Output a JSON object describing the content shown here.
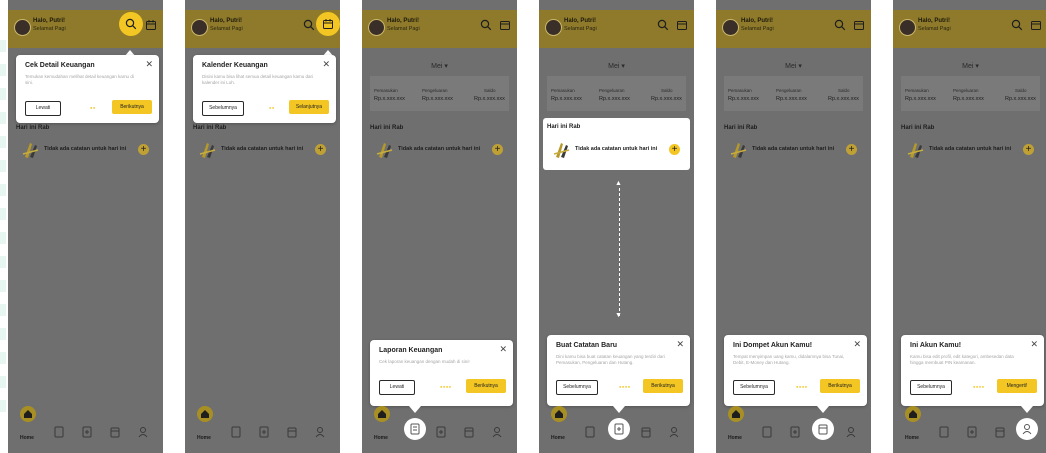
{
  "colors": {
    "accent": "#f3c623",
    "overlay": "#6f6f6f",
    "card": "#ffffff"
  },
  "common": {
    "hello": "Halo, Putri!",
    "greeting": "Selamat Pagi",
    "month": "Mei",
    "income_label": "Pemasukan",
    "expense_label": "Pengeluaran",
    "balance_label": "Saldo",
    "amount": "Rp.x.xxx.xxx",
    "day_title": "Hari ini Rab",
    "empty_text": "Tidak ada catatan untuk hari ini",
    "home_label": "Home",
    "icons": [
      "search-icon",
      "calendar-icon",
      "home-icon",
      "report-icon",
      "add-note-icon",
      "wallet-icon",
      "profile-icon"
    ]
  },
  "cards": [
    {
      "title": "Cek Detail Keuangan",
      "desc": "Temukan kemudahan melihat detail keuangan kamu di sini.",
      "left": "Lewati",
      "right": "Berikutnya"
    },
    {
      "title": "Kalender Keuangan",
      "desc": "Disini kamu bisa lihat semua detail keuangan kamu dari kalender ini Loh.",
      "left": "Sebelumnya",
      "right": "Selanjutnya"
    },
    {
      "title": "Laporan Keuangan",
      "desc": "Cek laporan keuangan dengan mudah di sini!",
      "left": "Lewati",
      "right": "Berikutnya"
    },
    {
      "title": "Buat Catatan Baru",
      "desc": "Dini kamu bisa buat catatan keuangan yang terdiri dari Pemasukan, Pengeluaran dan Hutang.",
      "left": "Sebelumnya",
      "right": "Berikutnya"
    },
    {
      "title": "Ini Dompet Akun Kamu!",
      "desc": "Tempat menyimpan uang kamu, didalamnya bisa Tunai, Debit, E-Money dan Hutang.",
      "left": "Sebelumnya",
      "right": "Berikutnya"
    },
    {
      "title": "Ini Akun Kamu!",
      "desc": "Kamu bisa edit profil, edit kategori, ambesedan data hingga membuat PIN keamanan.",
      "left": "Sebelumnya",
      "right": "Mengerti!"
    }
  ],
  "close_glyph": "✕",
  "plus_glyph": "+",
  "dots": [
    "●●",
    "●●",
    "●●●●",
    "●●●●",
    "●●●●",
    "●●●●"
  ]
}
